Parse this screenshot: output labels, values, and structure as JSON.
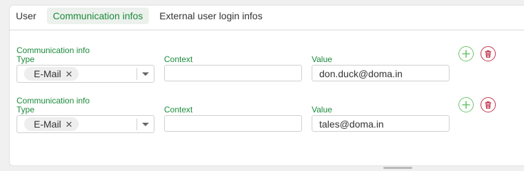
{
  "tabs": [
    {
      "label": "User"
    },
    {
      "label": "Communication infos"
    },
    {
      "label": "External user login infos"
    }
  ],
  "rows": [
    {
      "type_label_line1": "Communication info",
      "type_label_line2": "Type",
      "type_value": "E-Mail",
      "context_label": "Context",
      "context_value": "",
      "value_label": "Value",
      "value": "don.duck@doma.in"
    },
    {
      "type_label_line1": "Communication info",
      "type_label_line2": "Type",
      "type_value": "E-Mail",
      "context_label": "Context",
      "context_value": "",
      "value_label": "Value",
      "value": "tales@doma.in"
    }
  ],
  "colors": {
    "accent": "#1a8a3a",
    "add": "#6cc46c",
    "delete": "#c0334a"
  },
  "icons": {
    "add": "plus-icon",
    "delete": "trash-icon",
    "remove_chip": "close-icon",
    "dropdown": "chevron-down-icon"
  }
}
